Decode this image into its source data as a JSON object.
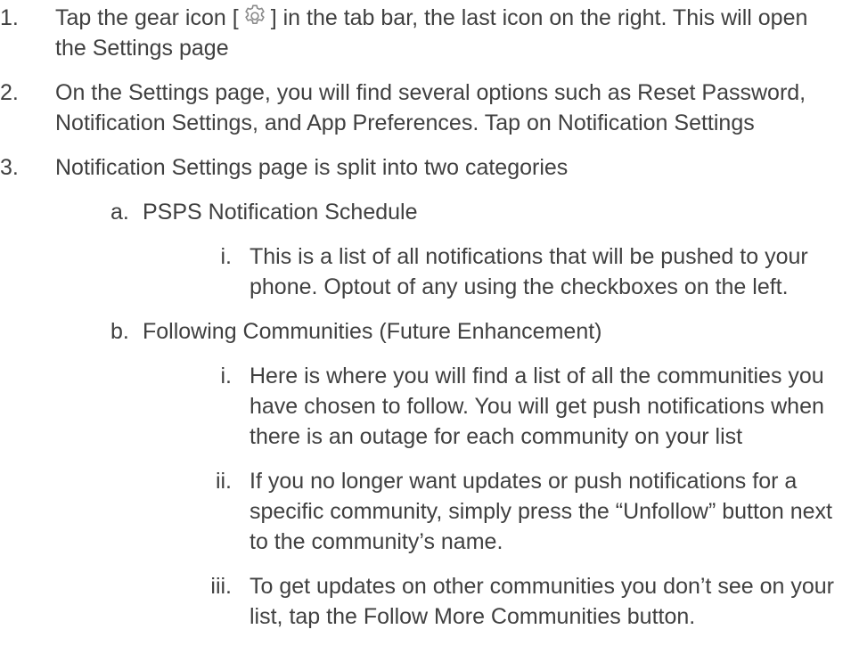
{
  "steps": [
    {
      "marker": "1.",
      "text_before_icon": "Tap the gear icon [",
      "icon": "gear-icon",
      "text_after_icon": "] in the tab bar, the last icon on the right. This will open the Settings page"
    },
    {
      "marker": "2.",
      "text": "On the Settings page, you will find several options such as Reset Password, Notification Settings, and App Preferences. Tap on Notification Settings"
    },
    {
      "marker": "3.",
      "text": "Notification Settings page is split into two categories",
      "sub": [
        {
          "marker": "a.",
          "text": "PSPS Notification Schedule",
          "sub": [
            {
              "marker": "i.",
              "text": "This is a list of all notifications that will be pushed to your phone. Optout of any using the checkboxes on the left."
            }
          ]
        },
        {
          "marker": "b.",
          "text": "Following Communities (Future Enhancement)",
          "sub": [
            {
              "marker": "i.",
              "text": "Here is where you will find a list of all the communities you have chosen to follow. You will get push notifications when there is an outage for each community on your list"
            },
            {
              "marker": "ii.",
              "text": "If you no longer want updates or push notifications for a specific community, simply press the “Unfollow” button next to the community’s name."
            },
            {
              "marker": "iii.",
              "text": "To get updates on other communities you don’t see on your list, tap the Follow More Communities button."
            }
          ]
        }
      ]
    }
  ],
  "colors": {
    "text": "#404040",
    "icon_stroke": "#8a8a8a"
  }
}
